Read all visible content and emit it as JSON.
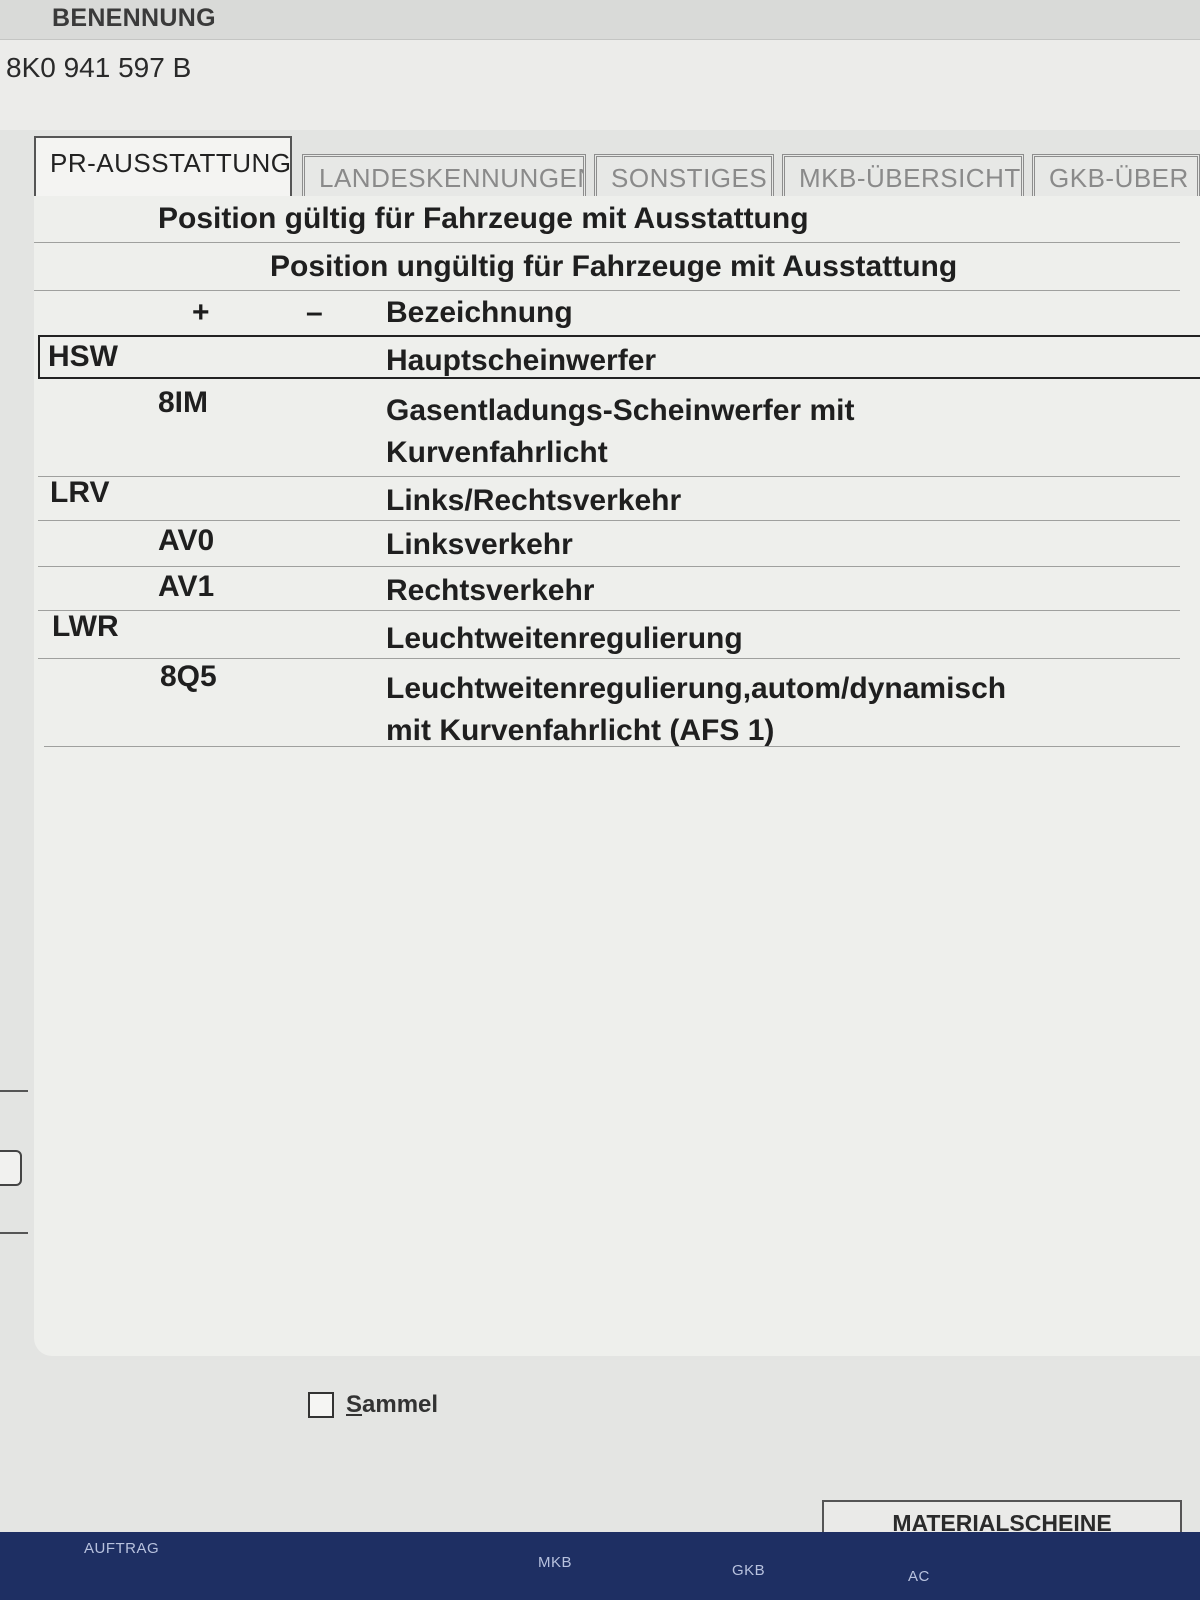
{
  "header": {
    "label": "BENENNUNG",
    "part_number": "8K0 941 597 B"
  },
  "tabs": [
    {
      "label": "PR-AUSSTATTUNG",
      "active": true
    },
    {
      "label": "LANDESKENNUNGEN",
      "active": false
    },
    {
      "label": "SONSTIGES",
      "active": false
    },
    {
      "label": "MKB-ÜBERSICHT",
      "active": false
    },
    {
      "label": "GKB-ÜBER",
      "active": false
    }
  ],
  "table": {
    "header_valid": "Position gültig für Fahrzeuge mit Ausstattung",
    "header_invalid": "Position ungültig für Fahrzeuge mit Ausstattung",
    "col_plus": "+",
    "col_minus": "–",
    "col_desc": "Bezeichnung",
    "rows": [
      {
        "group": "HSW",
        "plus": "",
        "desc": [
          "Hauptscheinwerfer"
        ],
        "selected": true
      },
      {
        "group": "",
        "plus": "8IM",
        "desc": [
          "Gasentladungs-Scheinwerfer mit",
          "Kurvenfahrlicht"
        ]
      },
      {
        "group": "LRV",
        "plus": "",
        "desc": [
          "Links/Rechtsverkehr"
        ]
      },
      {
        "group": "",
        "plus": "AV0",
        "desc": [
          "Linksverkehr"
        ]
      },
      {
        "group": "",
        "plus": "AV1",
        "desc": [
          "Rechtsverkehr"
        ]
      },
      {
        "group": "LWR",
        "plus": "",
        "desc": [
          "Leuchtweitenregulierung"
        ]
      },
      {
        "group": "",
        "plus": "8Q5",
        "desc": [
          "Leuchtweitenregulierung,autom/dynamisch",
          "mit Kurvenfahrlicht (AFS 1)"
        ]
      }
    ]
  },
  "footer": {
    "checkbox_underlined": "S",
    "checkbox_rest": "ammel",
    "checkbox_checked": false,
    "button_underlined": "M",
    "button_rest": "ATERIALSCHEINE"
  },
  "bottom_bar": {
    "items": [
      "AUFTRAG",
      "MKB",
      "GKB",
      "AC"
    ]
  }
}
